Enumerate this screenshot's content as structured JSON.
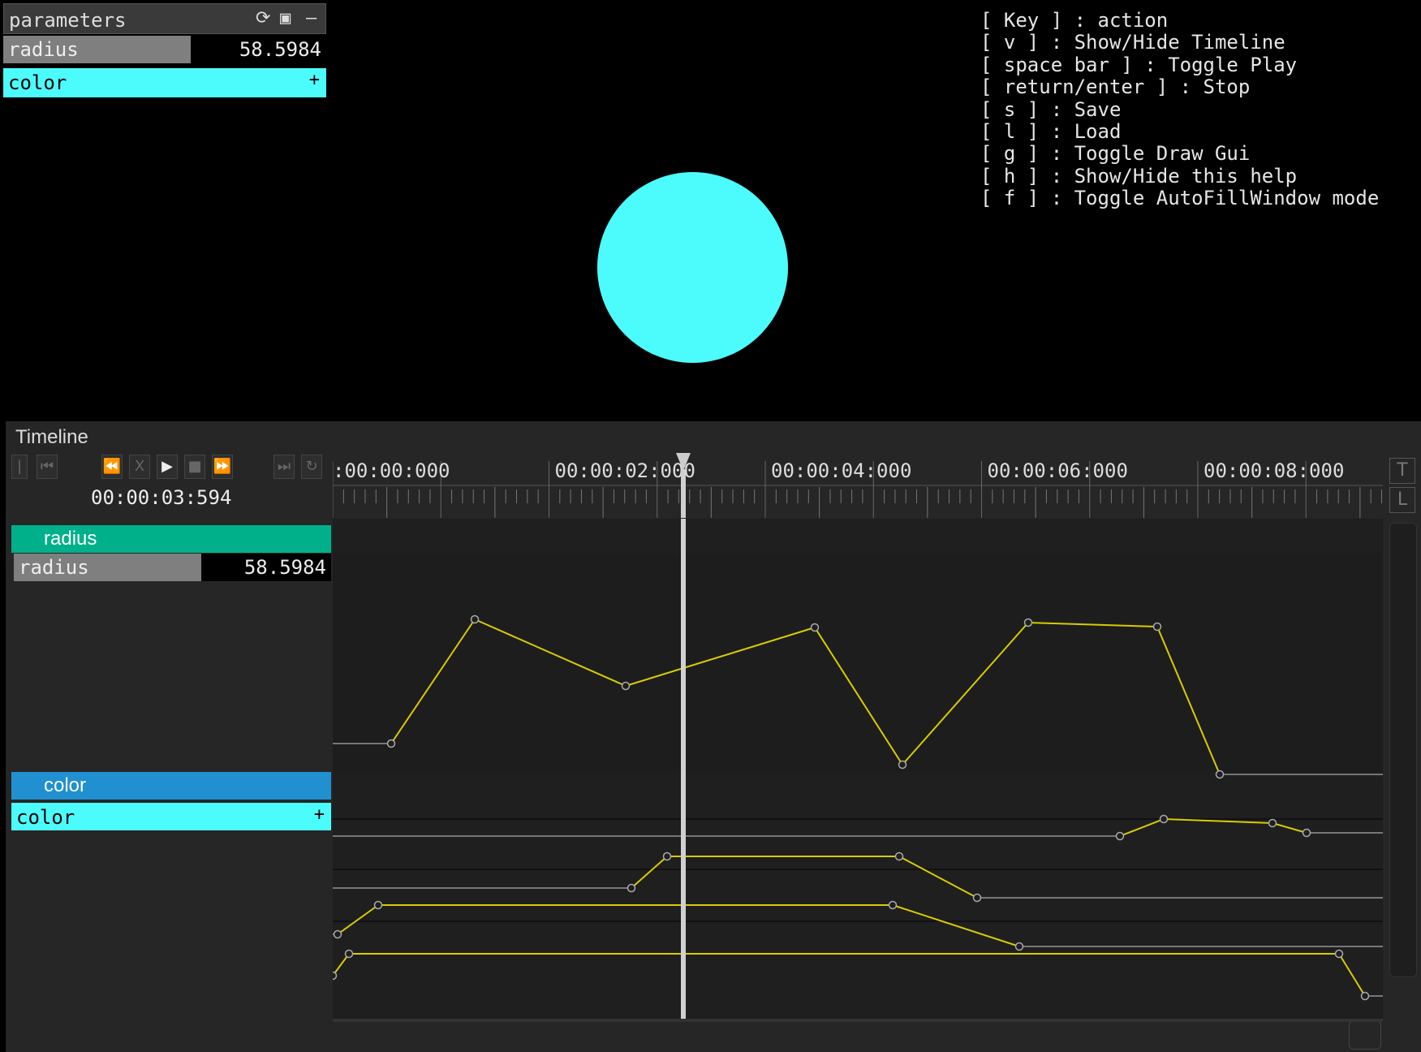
{
  "parameters": {
    "title": "parameters",
    "radius": {
      "label": "radius",
      "value": "58.5984",
      "fraction": 0.58
    },
    "color": {
      "label": "color",
      "plus": "+"
    }
  },
  "help": {
    "lines": [
      "[ Key ] : action",
      "[ v ] : Show/Hide Timeline",
      "[ space bar ] : Toggle Play",
      "[ return/enter ] : Stop",
      "[ s ] : Save",
      "[ l ] : Load",
      "[ g ] : Toggle Draw Gui",
      "[ h ] : Show/Hide this help",
      "[ f ] : Toggle AutoFillWindow mode"
    ]
  },
  "scene": {
    "circle_color": "#4cfcfc"
  },
  "timeline": {
    "title": "Timeline",
    "clock": "00:00:03:594",
    "transport": {
      "icons": [
        "go-start-icon",
        "step-back-icon",
        "rewind-icon",
        "x-icon",
        "play-icon",
        "stop-icon",
        "fast-forward-icon",
        "go-end-icon",
        "loop-icon"
      ],
      "x_label": "X"
    },
    "ruler_labels": [
      ":00:00:000",
      "00:00:02:000",
      "00:00:04:000",
      "00:00:06:000",
      "00:00:08:000"
    ],
    "side_buttons": {
      "t": "T",
      "l": "L"
    },
    "tracks": {
      "radius": {
        "header": "radius",
        "band": "radius",
        "slider_label": "radius",
        "slider_value": "58.5984",
        "slider_fraction": 0.59,
        "header_color": "#00b08a",
        "band_color": "#005e48"
      },
      "color": {
        "header": "color",
        "band": "color",
        "swatch_label": "color",
        "plus": "+",
        "header_color": "#2190d0",
        "band_color": "#134f6e"
      }
    }
  }
}
